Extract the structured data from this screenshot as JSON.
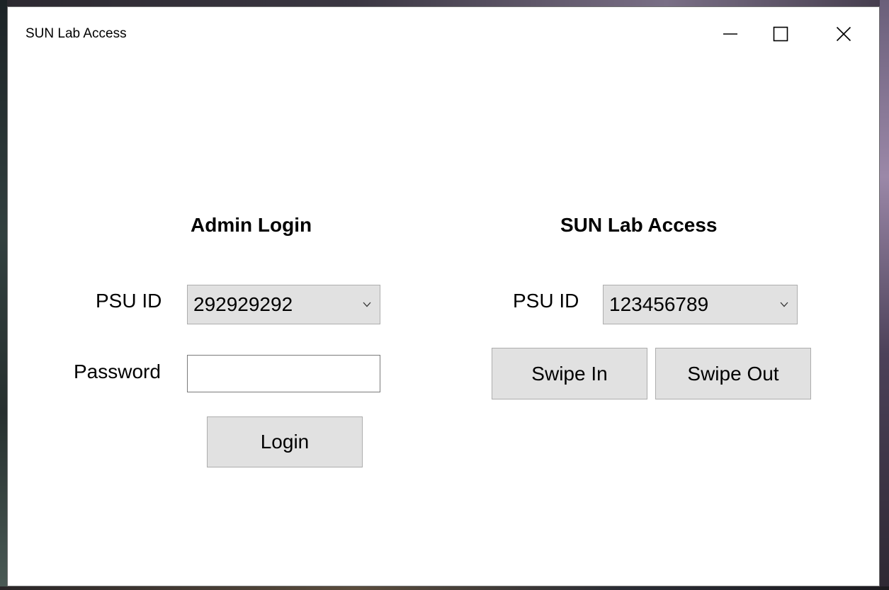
{
  "window": {
    "title": "SUN Lab Access",
    "controls": {
      "minimize_icon": "minimize-icon",
      "maximize_icon": "maximize-icon",
      "close_icon": "close-icon"
    }
  },
  "admin": {
    "heading": "Admin Login",
    "psu_id_label": "PSU ID",
    "psu_id_value": "292929292",
    "password_label": "Password",
    "password_value": "",
    "login_label": "Login"
  },
  "access": {
    "heading": "SUN Lab Access",
    "psu_id_label": "PSU ID",
    "psu_id_value": "123456789",
    "swipe_in_label": "Swipe In",
    "swipe_out_label": "Swipe Out"
  },
  "colors": {
    "window_bg": "#ffffff",
    "control_bg": "#e1e1e1",
    "control_border": "#adadad",
    "text": "#000000"
  }
}
